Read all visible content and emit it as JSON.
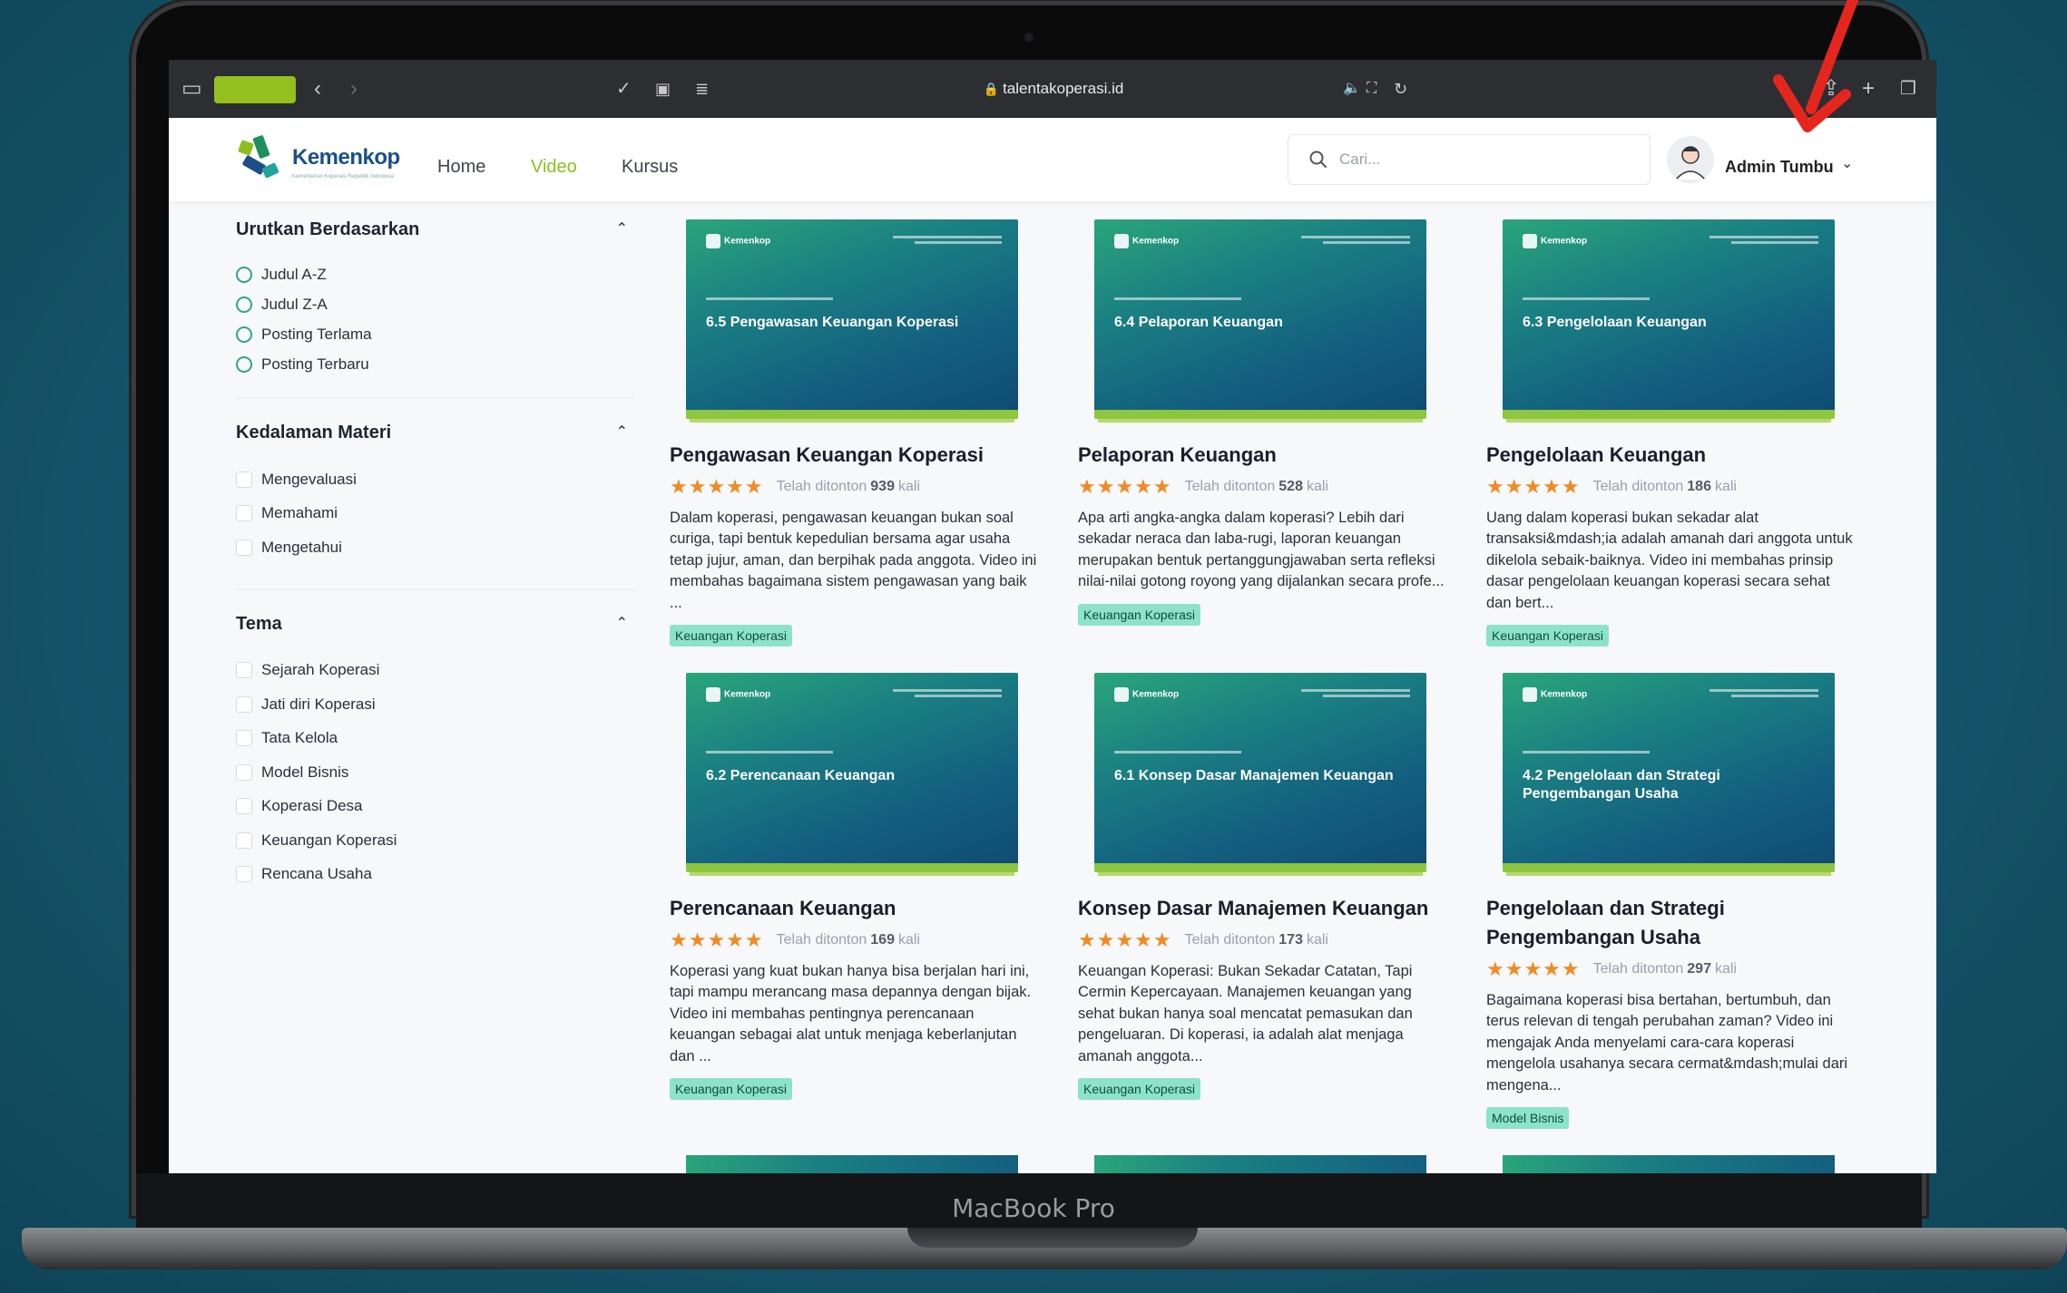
{
  "browser": {
    "url": "talentakoperasi.id"
  },
  "laptop": {
    "model_label": "MacBook Pro"
  },
  "header": {
    "logo_text": "Kemenkop",
    "logo_sub": "Kementerian Koperasi Republik Indonesia",
    "nav": [
      {
        "label": "Home",
        "active": false
      },
      {
        "label": "Video",
        "active": true
      },
      {
        "label": "Kursus",
        "active": false
      }
    ],
    "search_placeholder": "Cari...",
    "user_name": "Admin Tumbu"
  },
  "sidebar": {
    "sort": {
      "title": "Urutkan Berdasarkan",
      "options": [
        "Judul A-Z",
        "Judul Z-A",
        "Posting Terlama",
        "Posting Terbaru"
      ]
    },
    "depth": {
      "title": "Kedalaman Materi",
      "options": [
        "Mengevaluasi",
        "Memahami",
        "Mengetahui"
      ]
    },
    "theme": {
      "title": "Tema",
      "options": [
        "Sejarah Koperasi",
        "Jati diri Koperasi",
        "Tata Kelola",
        "Model Bisnis",
        "Koperasi Desa",
        "Keuangan Koperasi",
        "Rencana Usaha"
      ]
    }
  },
  "cards": [
    {
      "thumb_brand": "Kemenkop",
      "thumb_title": "6.5 Pengawasan Keuangan Koperasi",
      "title": "Pengawasan Keuangan Koperasi",
      "stars": "★★★★★",
      "views_prefix": "Telah ditonton",
      "views": "939",
      "views_suffix": "kali",
      "desc": "Dalam koperasi, pengawasan keuangan bukan soal curiga, tapi bentuk kepedulian bersama agar usaha tetap jujur, aman, dan berpihak pada anggota. Video ini membahas bagaimana sistem pengawasan yang baik ...",
      "tag": "Keuangan Koperasi"
    },
    {
      "thumb_brand": "Kemenkop",
      "thumb_title": "6.4 Pelaporan Keuangan",
      "title": "Pelaporan Keuangan",
      "stars": "★★★★★",
      "views_prefix": "Telah ditonton",
      "views": "528",
      "views_suffix": "kali",
      "desc": "Apa arti angka-angka dalam koperasi? Lebih dari sekadar neraca dan laba-rugi, laporan keuangan merupakan bentuk pertanggungjawaban serta refleksi nilai-nilai gotong royong yang dijalankan secara profe...",
      "tag": "Keuangan Koperasi"
    },
    {
      "thumb_brand": "Kemenkop",
      "thumb_title": "6.3 Pengelolaan Keuangan",
      "title": "Pengelolaan Keuangan",
      "stars": "★★★★★",
      "views_prefix": "Telah ditonton",
      "views": "186",
      "views_suffix": "kali",
      "desc": "Uang dalam koperasi bukan sekadar alat transaksi&mdash;ia adalah amanah dari anggota untuk dikelola sebaik-baiknya. Video ini membahas prinsip dasar pengelolaan keuangan koperasi secara sehat dan bert...",
      "tag": "Keuangan Koperasi"
    },
    {
      "thumb_brand": "Kemenkop",
      "thumb_title": "6.2 Perencanaan Keuangan",
      "title": "Perencanaan Keuangan",
      "stars": "★★★★★",
      "views_prefix": "Telah ditonton",
      "views": "169",
      "views_suffix": "kali",
      "desc": "Koperasi yang kuat bukan hanya bisa berjalan hari ini, tapi mampu merancang masa depannya dengan bijak. Video ini membahas pentingnya perencanaan keuangan sebagai alat untuk menjaga keberlanjutan dan ...",
      "tag": "Keuangan Koperasi"
    },
    {
      "thumb_brand": "Kemenkop",
      "thumb_title": "6.1 Konsep Dasar Manajemen Keuangan",
      "title": "Konsep Dasar Manajemen Keuangan",
      "stars": "★★★★★",
      "views_prefix": "Telah ditonton",
      "views": "173",
      "views_suffix": "kali",
      "desc": "Keuangan Koperasi: Bukan Sekadar Catatan, Tapi Cermin Kepercayaan. Manajemen keuangan yang sehat bukan hanya soal mencatat pemasukan dan pengeluaran. Di koperasi, ia adalah alat menjaga amanah anggota...",
      "tag": "Keuangan Koperasi"
    },
    {
      "thumb_brand": "Kemenkop",
      "thumb_title": "4.2 Pengelolaan dan Strategi Pengembangan Usaha",
      "title": "Pengelolaan dan Strategi Pengembangan Usaha",
      "stars": "★★★★★",
      "views_prefix": "Telah ditonton",
      "views": "297",
      "views_suffix": "kali",
      "desc": "Bagaimana koperasi bisa bertahan, bertumbuh, dan terus relevan di tengah perubahan zaman? Video ini mengajak Anda menyelami cara-cara koperasi mengelola usahanya secara cermat&mdash;mulai dari mengena...",
      "tag": "Model Bisnis"
    }
  ],
  "colors": {
    "accent_green": "#8bbf1e",
    "star_orange": "#f08a24",
    "tag_bg": "#8ce3c8",
    "annotation_red": "#e5261f"
  }
}
